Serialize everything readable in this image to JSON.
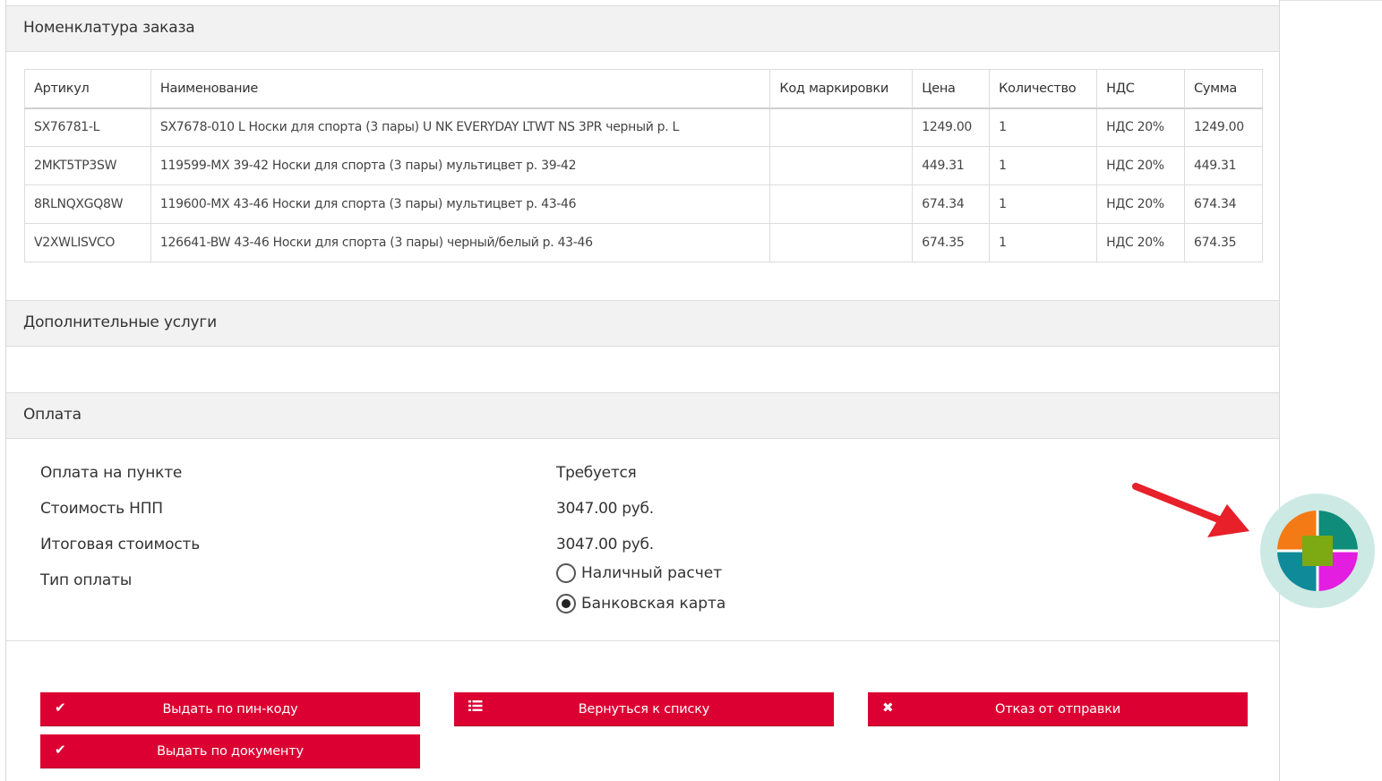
{
  "sections": {
    "nomenclature_title": "Номенклатура заказа",
    "extra_services_title": "Дополнительные услуги",
    "payment_title": "Оплата"
  },
  "table": {
    "columns": [
      "Артикул",
      "Наименование",
      "Код маркировки",
      "Цена",
      "Количество",
      "НДС",
      "Сумма"
    ],
    "rows": [
      [
        "SX76781-L",
        "SX7678-010 L Носки для спорта (3 пары) U NK EVERYDAY LTWT NS 3PR черный р. L",
        "",
        "1249.00",
        "1",
        "НДС 20%",
        "1249.00"
      ],
      [
        "2MKT5TP3SW",
        "119599-MX 39-42 Носки для спорта (3 пары) мультицвет р. 39-42",
        "",
        "449.31",
        "1",
        "НДС 20%",
        "449.31"
      ],
      [
        "8RLNQXGQ8W",
        "119600-MX 43-46 Носки для спорта (3 пары) мультицвет р. 43-46",
        "",
        "674.34",
        "1",
        "НДС 20%",
        "674.34"
      ],
      [
        "V2XWLISVCO",
        "126641-BW 43-46 Носки для спорта (3 пары) черный/белый р. 43-46",
        "",
        "674.35",
        "1",
        "НДС 20%",
        "674.35"
      ]
    ]
  },
  "payment": {
    "labels": {
      "pay_at_point": "Оплата на пункте",
      "cost_npp": "Стоимость НПП",
      "total_cost": "Итоговая стоимость",
      "payment_type": "Тип оплаты"
    },
    "values": {
      "pay_at_point": "Требуется",
      "cost_npp": "3047.00 руб.",
      "total_cost": "3047.00 руб."
    },
    "options": [
      {
        "label": "Наличный расчет",
        "checked": false
      },
      {
        "label": "Банковская карта",
        "checked": true
      }
    ]
  },
  "buttons": {
    "issue_by_pin": "Выдать по пин-коду",
    "back_to_list": "Вернуться к списку",
    "refuse_dispatch": "Отказ от отправки",
    "issue_by_document": "Выдать по документу"
  },
  "icons": {
    "check": "check-icon",
    "list": "list-icon",
    "close": "close-icon"
  },
  "colors": {
    "primary_button": "#dc0032",
    "section_header_bg": "#f2f2f2",
    "arrow": "#e8202a",
    "widget_ring": "#cde9e4"
  }
}
